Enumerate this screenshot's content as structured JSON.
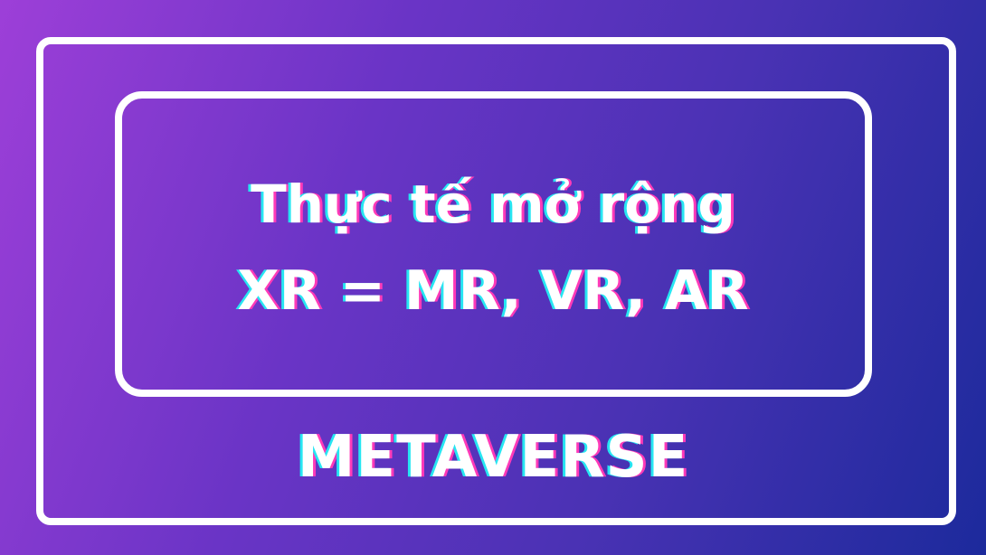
{
  "banner": {
    "title_line_1": "Thực tế mở rộng",
    "title_line_2": "XR = MR, VR, AR",
    "footer_text": "METAVERSE"
  },
  "colors": {
    "gradient_start": "#9d3fd8",
    "gradient_end": "#1c2a9c",
    "frame": "#ffffff",
    "text": "#ffffff",
    "glitch_cyan": "#27e6f2",
    "glitch_pink": "#ff3ab8"
  }
}
